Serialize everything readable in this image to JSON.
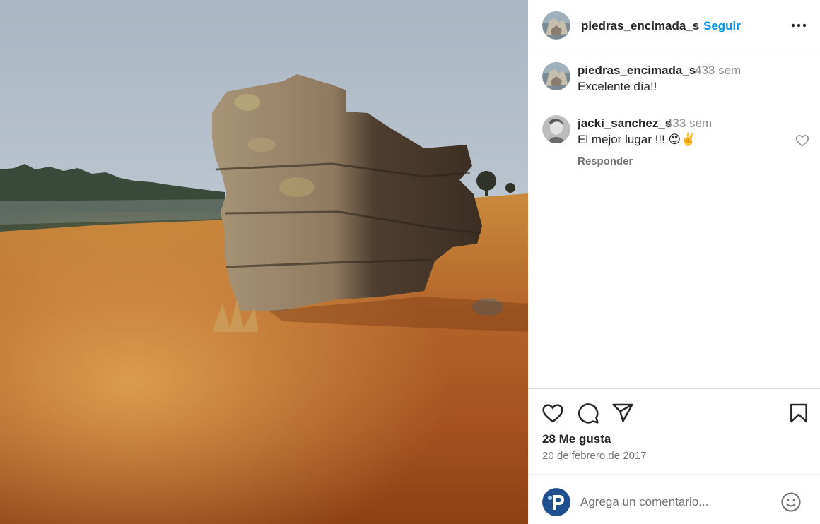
{
  "post": {
    "image_alt": "Piedras Encimadas rock formation",
    "author": {
      "username": "piedras_encimada_s",
      "dot": "•",
      "follow_label": "Seguir",
      "more_icon": "more-horizontal-icon"
    },
    "comments": [
      {
        "username": "piedras_encimada_s",
        "time": "433 sem",
        "text": "Excelente día!!"
      },
      {
        "username": "jacki_sanchez_s",
        "time": "433 sem",
        "text": "El mejor lugar !!! 😍✌️",
        "reply_label": "Responder",
        "like_icon": "heart-outline-icon"
      }
    ],
    "actions": {
      "like_icon": "heart-outline-icon",
      "comment_icon": "comment-bubble-icon",
      "share_icon": "paper-plane-icon",
      "save_icon": "bookmark-icon"
    },
    "likes_label": "28 Me gusta",
    "date_label": "20 de febrero de 2017",
    "comment_box": {
      "placeholder": "Agrega un comentario...",
      "emoji_icon": "smiley-icon"
    }
  },
  "colors": {
    "accent": "#0095f6",
    "text_primary": "#262626",
    "text_secondary": "#737373",
    "border": "#dbdbdb"
  }
}
